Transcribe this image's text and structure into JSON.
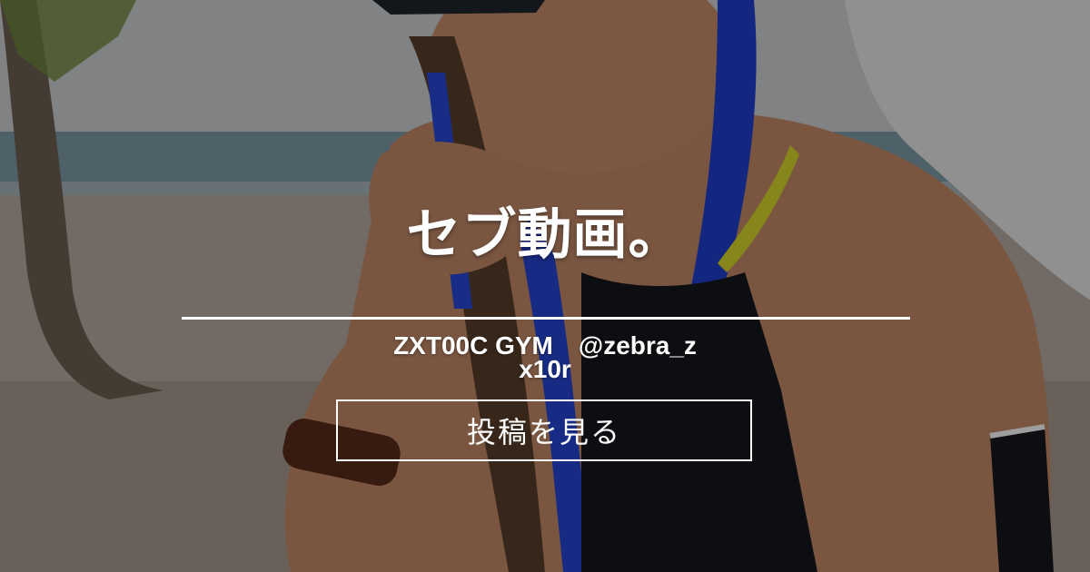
{
  "card": {
    "title": "セブ動画。",
    "creator_line": "ZXT00C GYM　@zebra_zx10r",
    "cta_label": "投稿を見る"
  },
  "colors": {
    "overlay": "#000000",
    "text": "#ffffff",
    "sky": "#c9cdd1",
    "sea": "#7c9aa8",
    "sand": "#b9aea3",
    "hair_blue": "#1f3fd0",
    "hair_yellow": "#d7d82b",
    "skin": "#c98f6c",
    "swimsuit": "#15181c"
  }
}
